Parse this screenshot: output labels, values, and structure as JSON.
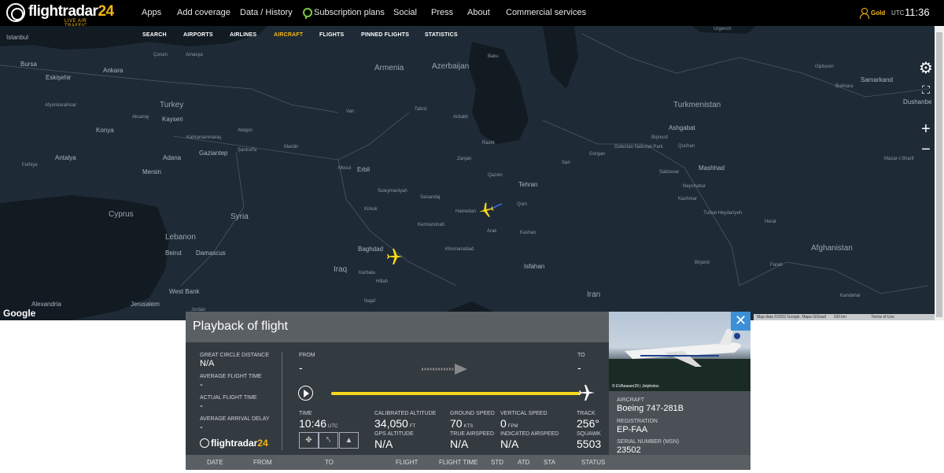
{
  "app": {
    "logo_text": "flightradar",
    "logo_num": "24",
    "tagline": "LIVE AIR TRAFFIC"
  },
  "topnav": {
    "items": [
      "Apps",
      "Add coverage",
      "Data / History",
      "Subscription plans",
      "Social",
      "Press",
      "About",
      "Commercial services"
    ],
    "account": "Gold",
    "utc_label": "UTC",
    "time": "11:36"
  },
  "subnav": {
    "items": [
      "SEARCH",
      "AIRPORTS",
      "AIRLINES",
      "AIRCRAFT",
      "FLIGHTS",
      "PINNED FLIGHTS",
      "STATISTICS"
    ],
    "active": "AIRCRAFT"
  },
  "map": {
    "countries": [
      "Azerbaijan",
      "Armenia",
      "Turkey",
      "Turkmenistan",
      "Syria",
      "Cyprus",
      "Lebanon",
      "Iraq",
      "Afghanistan",
      "Iran"
    ],
    "cities": [
      "Istanbul",
      "Bursa",
      "Eskişehir",
      "Ankara",
      "Çorum",
      "Amasya",
      "Afyonkarahisar",
      "Kayseri",
      "Konya",
      "Aksaray",
      "Antalya",
      "Mersin",
      "Adana",
      "Gaziantep",
      "Kahramanmaraş",
      "Şanlıurfa",
      "Mardin",
      "Van",
      "Baku",
      "Tabriz",
      "Ardabil",
      "Rasht",
      "Sari",
      "Gorgan",
      "Bojnurd",
      "Quchan",
      "Ashgabat",
      "Mashhad",
      "Sabzevar",
      "Neyshabur",
      "Kashmar",
      "Herat",
      "Turbat Heydariyeh",
      "Birjand",
      "Farah",
      "Kandahar",
      "Zanjan",
      "Qazvin",
      "Tehran",
      "Qom",
      "Hamedan",
      "Arak",
      "Kashan",
      "Isfahan",
      "Kermanshah",
      "Sanandaj",
      "Erbil",
      "Mosul",
      "Kirkuk",
      "Suleymaniyah",
      "Baghdad",
      "Karbala",
      "Hillah",
      "Najaf",
      "Khorramabad",
      "Damascus",
      "Beirut",
      "Jerusalem",
      "Alexandria",
      "Fethiye",
      "Samarkand",
      "Bukhara",
      "Dushanbe",
      "Mazar-i-Sharif",
      "Gijduvon",
      "Urgench",
      "Golestan National Park",
      "West Bank",
      "Jordan",
      "Aleppo"
    ],
    "google": "Google",
    "attribution": "Map data ©2022 Google, Mapa GISrael",
    "scale": "100 km",
    "terms": "Terms of Use"
  },
  "panel": {
    "title": "Playback of flight",
    "great_circle_label": "GREAT CIRCLE DISTANCE",
    "great_circle_value": "N/A",
    "avg_flight_time_label": "AVERAGE FLIGHT TIME",
    "avg_flight_time_value": "-",
    "actual_flight_time_label": "ACTUAL FLIGHT TIME",
    "actual_flight_time_value": "-",
    "avg_arrival_delay_label": "AVERAGE ARRIVAL DELAY",
    "avg_arrival_delay_value": "-",
    "from_label": "FROM",
    "from_value": "-",
    "to_label": "TO",
    "to_value": "-",
    "time_label": "TIME",
    "time_value": "10:46",
    "time_unit": "UTC",
    "cal_alt_label": "CALIBRATED ALTITUDE",
    "cal_alt_value": "34,050",
    "cal_alt_unit": "FT",
    "gps_alt_label": "GPS ALTITUDE",
    "gps_alt_value": "N/A",
    "ground_speed_label": "GROUND SPEED",
    "ground_speed_value": "70",
    "ground_speed_unit": "KTS",
    "true_airspeed_label": "TRUE AIRSPEED",
    "true_airspeed_value": "N/A",
    "vert_speed_label": "VERTICAL SPEED",
    "vert_speed_value": "0",
    "vert_speed_unit": "FPM",
    "ind_airspeed_label": "INDICATED AIRSPEED",
    "ind_airspeed_value": "N/A",
    "track_label": "TRACK",
    "track_value": "256°",
    "squawk_label": "SQUAWK",
    "squawk_value": "5503",
    "photo_credit": "© EVAeasen29 | Jetphotos",
    "aircraft_label": "AIRCRAFT",
    "aircraft_value": "Boeing 747-281B",
    "registration_label": "REGISTRATION",
    "registration_value": "EP-FAA",
    "serial_label": "SERIAL NUMBER (MSN)",
    "serial_value": "23502",
    "logo_text": "flightradar",
    "logo_num": "24",
    "playback_progress": 1.0
  },
  "table": {
    "headers": [
      "DATE",
      "FROM",
      "TO",
      "FLIGHT",
      "FLIGHT TIME",
      "STD",
      "ATD",
      "STA",
      "STATUS"
    ]
  },
  "colors": {
    "accent": "#f6b813",
    "track": "#f6d81e",
    "close": "#3d8fd6",
    "map_bg": "#1e2b36"
  }
}
